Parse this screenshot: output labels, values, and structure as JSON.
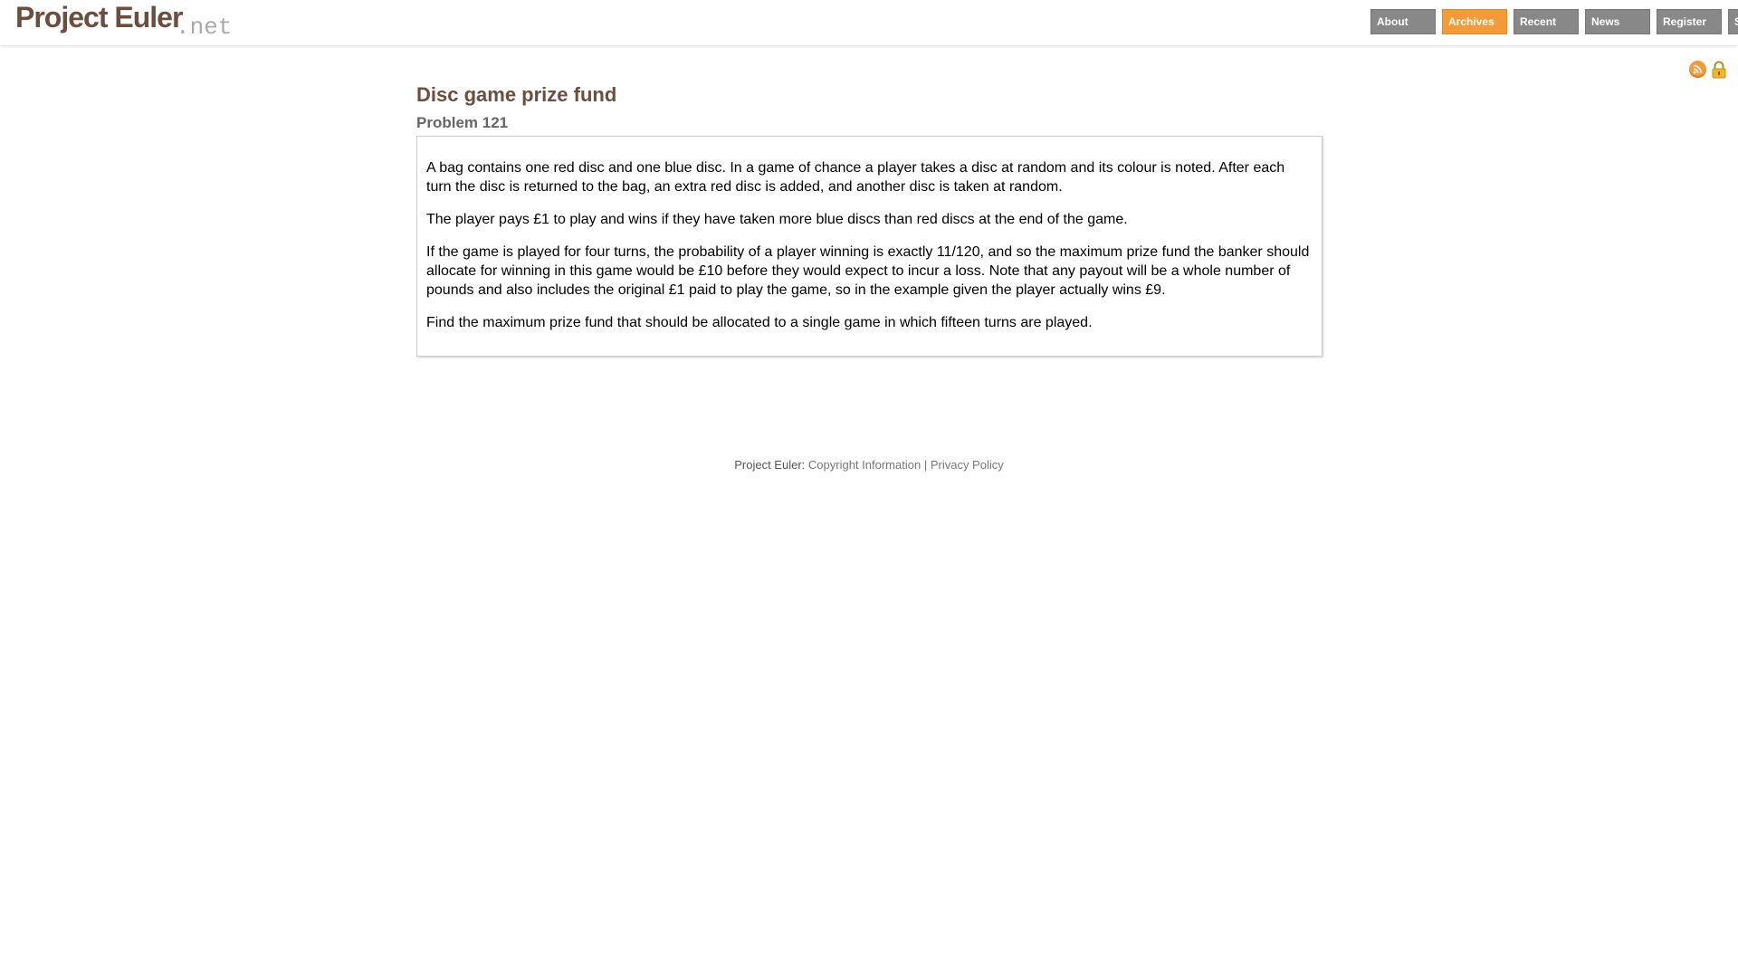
{
  "header": {
    "logo_main": "Project Euler",
    "logo_tld": ".net",
    "nav": [
      {
        "label": "About",
        "active": false
      },
      {
        "label": "Archives",
        "active": true
      },
      {
        "label": "Recent",
        "active": false
      },
      {
        "label": "News",
        "active": false
      },
      {
        "label": "Register",
        "active": false
      },
      {
        "label": "Sign In",
        "active": false
      }
    ]
  },
  "icons": {
    "rss": "rss-icon",
    "lock": "lock-icon"
  },
  "problem": {
    "title": "Disc game prize fund",
    "number": "Problem 121",
    "paragraphs": [
      "A bag contains one red disc and one blue disc. In a game of chance a player takes a disc at random and its colour is noted. After each turn the disc is returned to the bag, an extra red disc is added, and another disc is taken at random.",
      "The player pays £1 to play and wins if they have taken more blue discs than red discs at the end of the game.",
      "If the game is played for four turns, the probability of a player winning is exactly 11/120, and so the maximum prize fund the banker should allocate for winning in this game would be £10 before they would expect to incur a loss. Note that any payout will be a whole number of pounds and also includes the original £1 paid to play the game, so in the example given the player actually wins £9.",
      "Find the maximum prize fund that should be allocated to a single game in which fifteen turns are played."
    ]
  },
  "footer": {
    "prefix": "Project Euler:",
    "copyright_link": "Copyright Information",
    "separator": "|",
    "privacy_link": "Privacy Policy"
  },
  "colors": {
    "brand_brown": "#6b4e3d",
    "nav_gray": "#888888",
    "nav_active": "#f39b38"
  }
}
